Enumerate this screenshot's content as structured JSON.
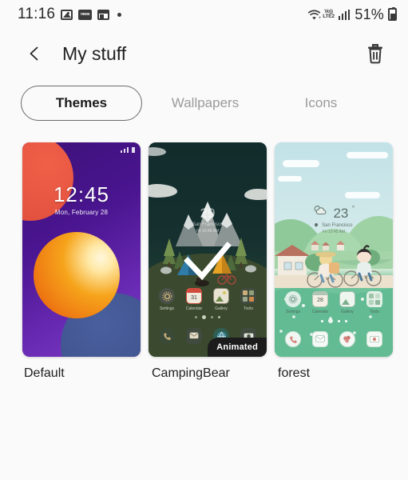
{
  "status_bar": {
    "time": "11:16",
    "left_icons": [
      "photo-icon",
      "news-badge-icon",
      "window-icon",
      "dot-icon"
    ],
    "news_badge_text": "news",
    "volte_top": "Vo))",
    "volte_bottom": "LTE2",
    "battery_percent": "51%",
    "right_icons": [
      "wifi-icon",
      "volte-icon",
      "signal-bars-icon",
      "battery-icon"
    ]
  },
  "app_bar": {
    "back_icon": "chevron-left-icon",
    "title": "My stuff",
    "delete_icon": "trash-icon"
  },
  "tabs": [
    {
      "label": "Themes",
      "active": true
    },
    {
      "label": "Wallpapers",
      "active": false
    },
    {
      "label": "Icons",
      "active": false
    }
  ],
  "themes": [
    {
      "name": "Default",
      "selected": false,
      "animated": false,
      "preview": {
        "clock": "12:45",
        "date": "Mon, February 28",
        "bg_color": "#4a1590",
        "accent_red": "#e8543c",
        "accent_orange": "#f09018",
        "accent_blue": "#3f538f"
      }
    },
    {
      "name": "CampingBear",
      "selected": true,
      "animated": true,
      "animated_label": "Animated",
      "preview": {
        "temperature": "29",
        "city": "San Francisco",
        "hour": "Fri 10:45 AM",
        "bg_color": "#16302f",
        "apps": [
          "Settings",
          "Calendar",
          "Gallery",
          "Tools"
        ],
        "calendar_day": "31"
      }
    },
    {
      "name": "forest",
      "selected": false,
      "animated": false,
      "preview": {
        "temperature": "23",
        "city": "San Francisco",
        "hour": "Fri 10:45 AM",
        "bg_color": "#c8e4e8",
        "apps": [
          "Settings",
          "Calendar",
          "Gallery",
          "Tools"
        ],
        "calendar_day": "28"
      }
    }
  ],
  "colors": {
    "page_bg": "#fafafa",
    "text_primary": "#202020",
    "text_muted": "#9a9a9a",
    "badge_bg": "#1c1c1c"
  }
}
